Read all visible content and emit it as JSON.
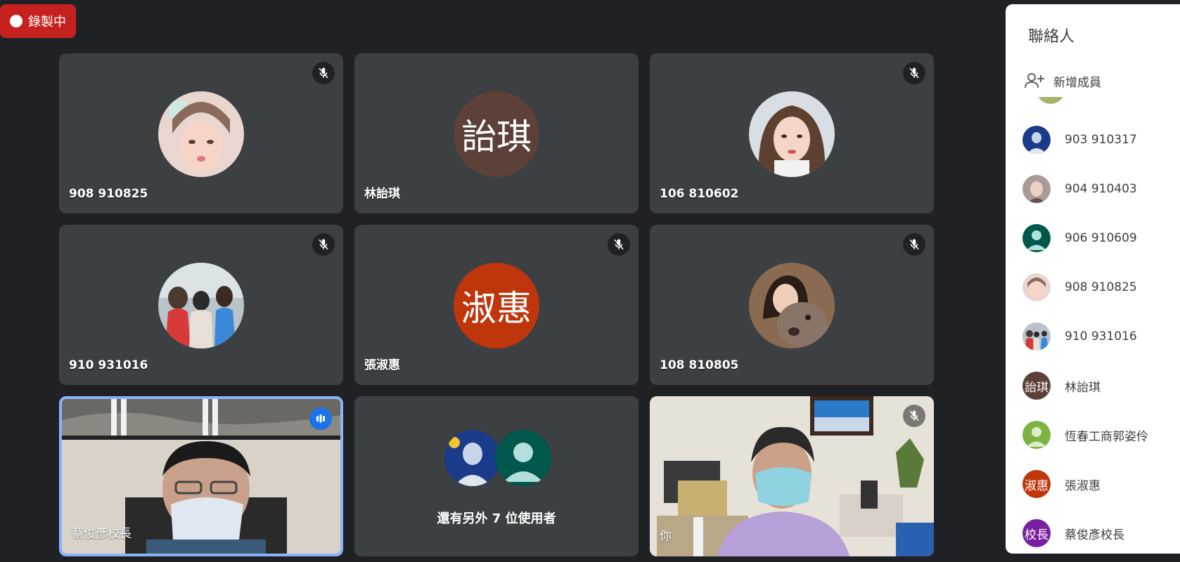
{
  "recording": {
    "label": "錄製中"
  },
  "tiles": [
    {
      "name": "908 910825",
      "muted": true
    },
    {
      "name": "林詒琪",
      "initials": "詒琪",
      "color": "#5d4037"
    },
    {
      "name": "106 810602",
      "muted": true
    },
    {
      "name": "910 931016",
      "muted": true
    },
    {
      "name": "張淑惠",
      "initials": "淑惠",
      "color": "#bf360c",
      "muted": true
    },
    {
      "name": "108 810805",
      "muted": true
    },
    {
      "name": "蔡俊彥校長",
      "speaking": true
    },
    {
      "more_label": "還有另外 7 位使用者"
    },
    {
      "name": "你",
      "muted": true
    }
  ],
  "panel": {
    "title": "聯絡人",
    "add_member": "新增成員",
    "contacts": [
      {
        "name": "903 910317"
      },
      {
        "name": "904 910403"
      },
      {
        "name": "906 910609",
        "color": "#00574b"
      },
      {
        "name": "908 910825"
      },
      {
        "name": "910 931016"
      },
      {
        "name": "林詒琪",
        "initials": "詒琪",
        "color": "#5d4037"
      },
      {
        "name": "恆春工商郭姿伶",
        "color": "#7cb342"
      },
      {
        "name": "張淑惠",
        "initials": "淑惠",
        "color": "#bf360c"
      },
      {
        "name": "蔡俊彥校長",
        "initials": "校長",
        "color": "#7b1fa2"
      }
    ]
  },
  "colors": {
    "background": "#202124",
    "tile": "#3c4043",
    "recording": "#c5221f",
    "speaking": "#1a73e8",
    "active_border": "#8ab4f8"
  }
}
